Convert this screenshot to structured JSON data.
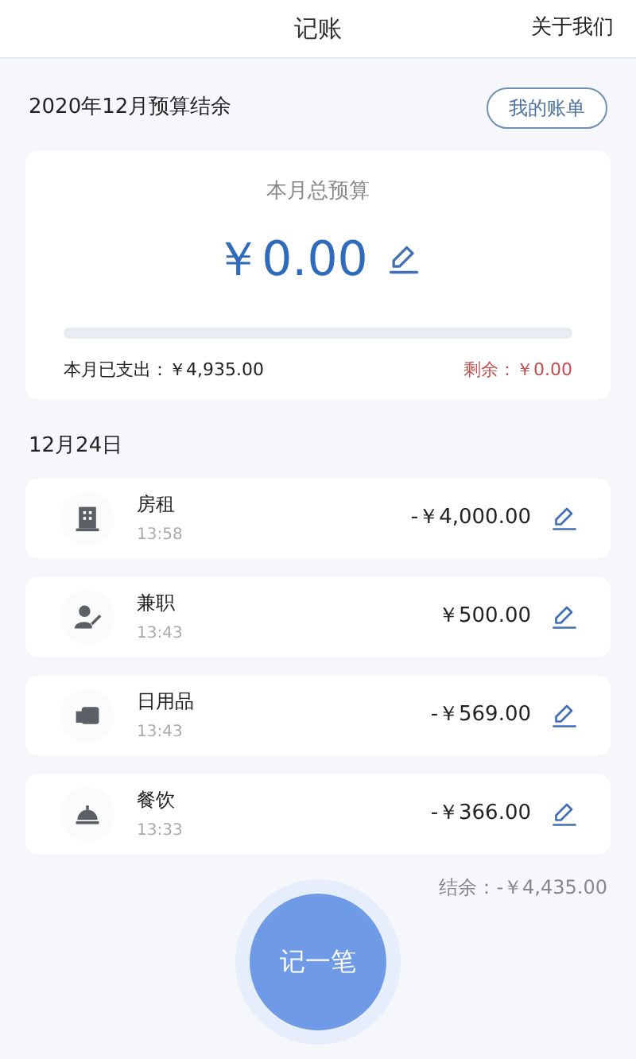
{
  "header": {
    "title": "记账",
    "about_link": "关于我们"
  },
  "summary": {
    "title": "2020年12月预算结余",
    "bills_button": "我的账单"
  },
  "budget_card": {
    "label": "本月总预算",
    "amount": "￥0.00",
    "spent": "本月已支出：￥4,935.00",
    "remaining": "剩余：￥0.00"
  },
  "day": {
    "date": "12月24日",
    "entries": [
      {
        "kind": "building",
        "name": "房租",
        "time": "13:58",
        "amount": "-￥4,000.00"
      },
      {
        "kind": "person",
        "name": "兼职",
        "time": "13:43",
        "amount": "￥500.00"
      },
      {
        "kind": "roll",
        "name": "日用品",
        "time": "13:43",
        "amount": "-￥569.00"
      },
      {
        "kind": "cloche",
        "name": "餐饮",
        "time": "13:33",
        "amount": "-￥366.00"
      }
    ],
    "balance": "结余：-￥4,435.00"
  },
  "add_button": "记一笔"
}
